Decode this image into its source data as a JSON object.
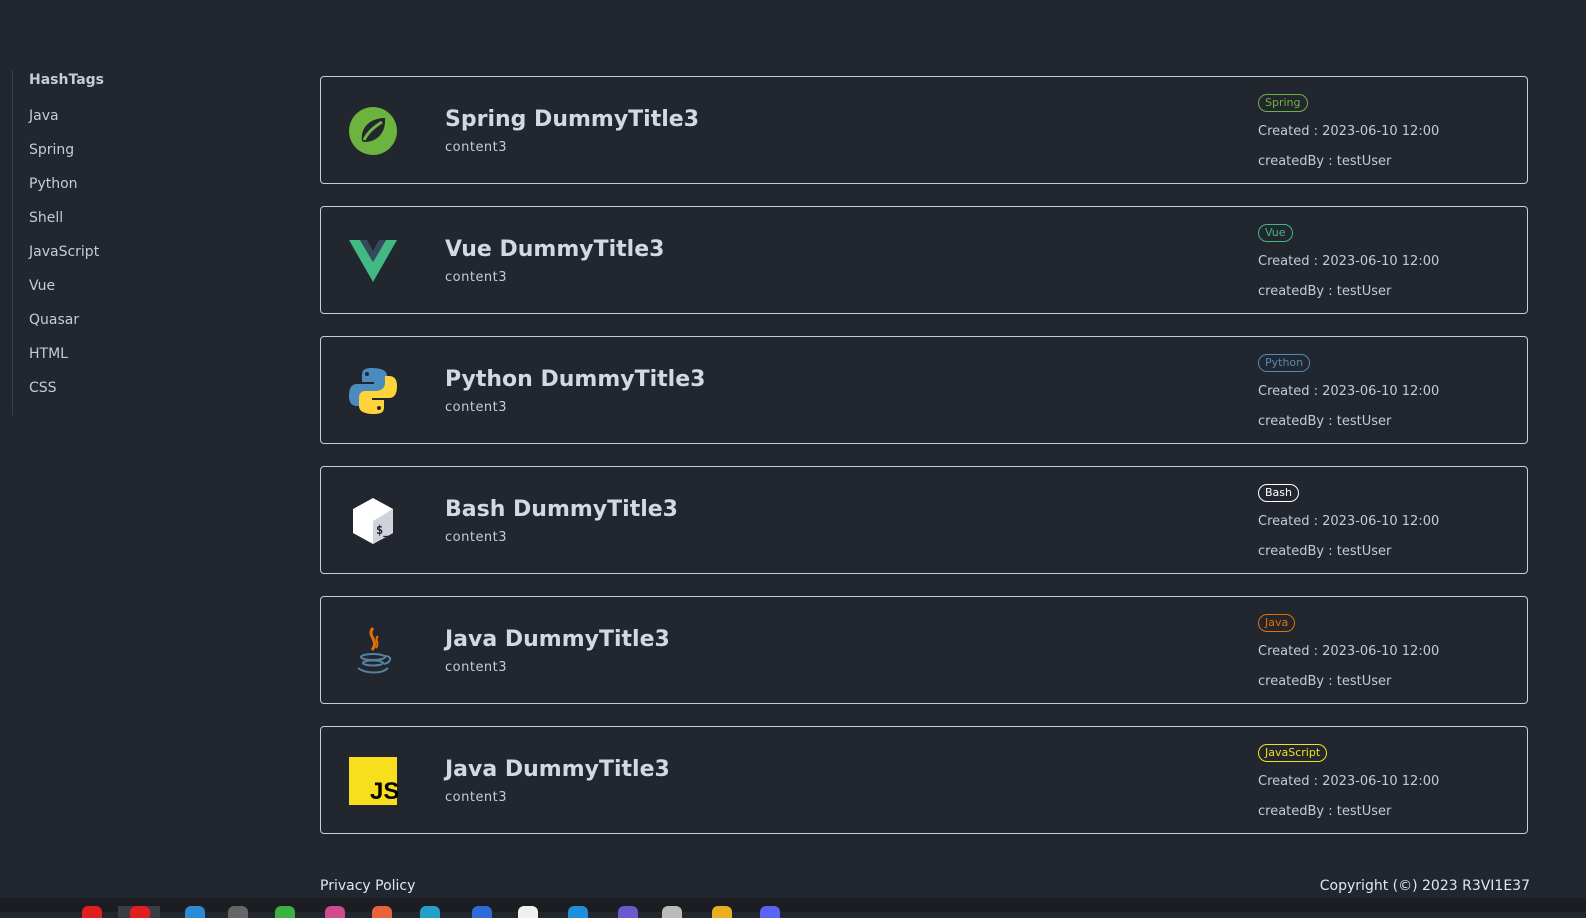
{
  "sidebar": {
    "heading": "HashTags",
    "tags": [
      "Java",
      "Spring",
      "Python",
      "Shell",
      "JavaScript",
      "Vue",
      "Quasar",
      "HTML",
      "CSS"
    ]
  },
  "posts": [
    {
      "title": "Spring DummyTitle3",
      "content": "content3",
      "tag": "Spring",
      "tag_color": "#6db33f",
      "created": "Created : 2023-06-10 12:00",
      "created_by": "createdBy : testUser",
      "icon": "spring-logo-icon"
    },
    {
      "title": "Vue DummyTitle3",
      "content": "content3",
      "tag": "Vue",
      "tag_color": "#42b883",
      "created": "Created : 2023-06-10 12:00",
      "created_by": "createdBy : testUser",
      "icon": "vue-logo-icon"
    },
    {
      "title": "Python DummyTitle3",
      "content": "content3",
      "tag": "Python",
      "tag_color": "#4b8bbe",
      "created": "Created : 2023-06-10 12:00",
      "created_by": "createdBy : testUser",
      "icon": "python-logo-icon"
    },
    {
      "title": "Bash DummyTitle3",
      "content": "content3",
      "tag": "Bash",
      "tag_color": "#ffffff",
      "created": "Created : 2023-06-10 12:00",
      "created_by": "createdBy : testUser",
      "icon": "bash-logo-icon"
    },
    {
      "title": "Java DummyTitle3",
      "content": "content3",
      "tag": "Java",
      "tag_color": "#e76f00",
      "created": "Created : 2023-06-10 12:00",
      "created_by": "createdBy : testUser",
      "icon": "java-logo-icon"
    },
    {
      "title": "Java DummyTitle3",
      "content": "content3",
      "tag": "JavaScript",
      "tag_color": "#f7df1e",
      "created": "Created : 2023-06-10 12:00",
      "created_by": "createdBy : testUser",
      "icon": "javascript-logo-icon"
    }
  ],
  "footer": {
    "privacy": "Privacy Policy",
    "copyright": "Copyright (©) 2023 R3VI1E37"
  },
  "logo_text": {
    "javascript": "JS",
    "bash": "$_"
  }
}
